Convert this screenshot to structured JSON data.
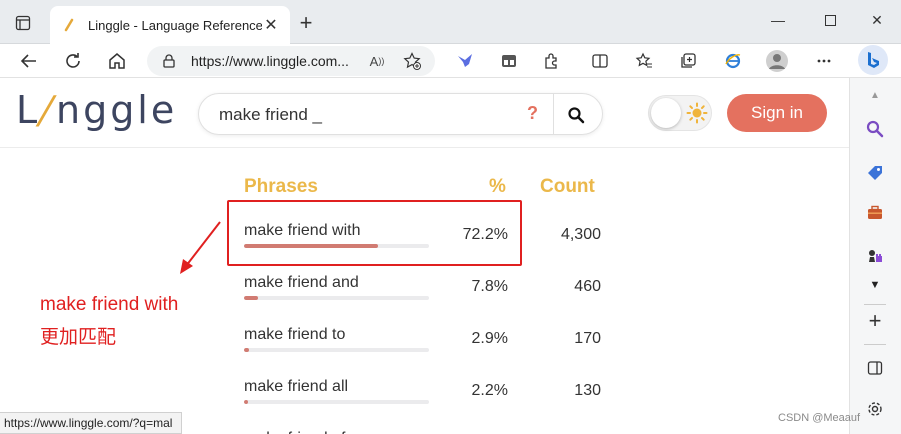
{
  "browser": {
    "tab_title": "Linggle - Language Reference Se",
    "url": "https://www.linggle.com...",
    "read_aloud_label": "A",
    "status_url": "https://www.linggle.com/?q=mal"
  },
  "site": {
    "logo_prefix": "L",
    "logo_slash": "/",
    "logo_suffix": "nggle",
    "search_query": "make friend _",
    "help_label": "?",
    "signin_label": "Sign in"
  },
  "results": {
    "headers": {
      "phrases": "Phrases",
      "percent": "%",
      "count": "Count"
    },
    "rows": [
      {
        "phrase": "make friend with",
        "percent": "72.2%",
        "count": "4,300",
        "fraction": 0.722
      },
      {
        "phrase": "make friend and",
        "percent": "7.8%",
        "count": "460",
        "fraction": 0.078
      },
      {
        "phrase": "make friend to",
        "percent": "2.9%",
        "count": "170",
        "fraction": 0.029
      },
      {
        "phrase": "make friend all",
        "percent": "2.2%",
        "count": "130",
        "fraction": 0.022
      },
      {
        "phrase": "make friend of",
        "percent": "",
        "count": "",
        "fraction": 0
      }
    ]
  },
  "annotation": {
    "line1": "make friend with",
    "line2": "更加匹配",
    "color": "#e02020"
  },
  "watermark": "CSDN @Meaauf",
  "colors": {
    "accent": "#e4715f",
    "header": "#ebb84a",
    "bar_fill": "#d17b72",
    "logo": "#3d4560"
  }
}
